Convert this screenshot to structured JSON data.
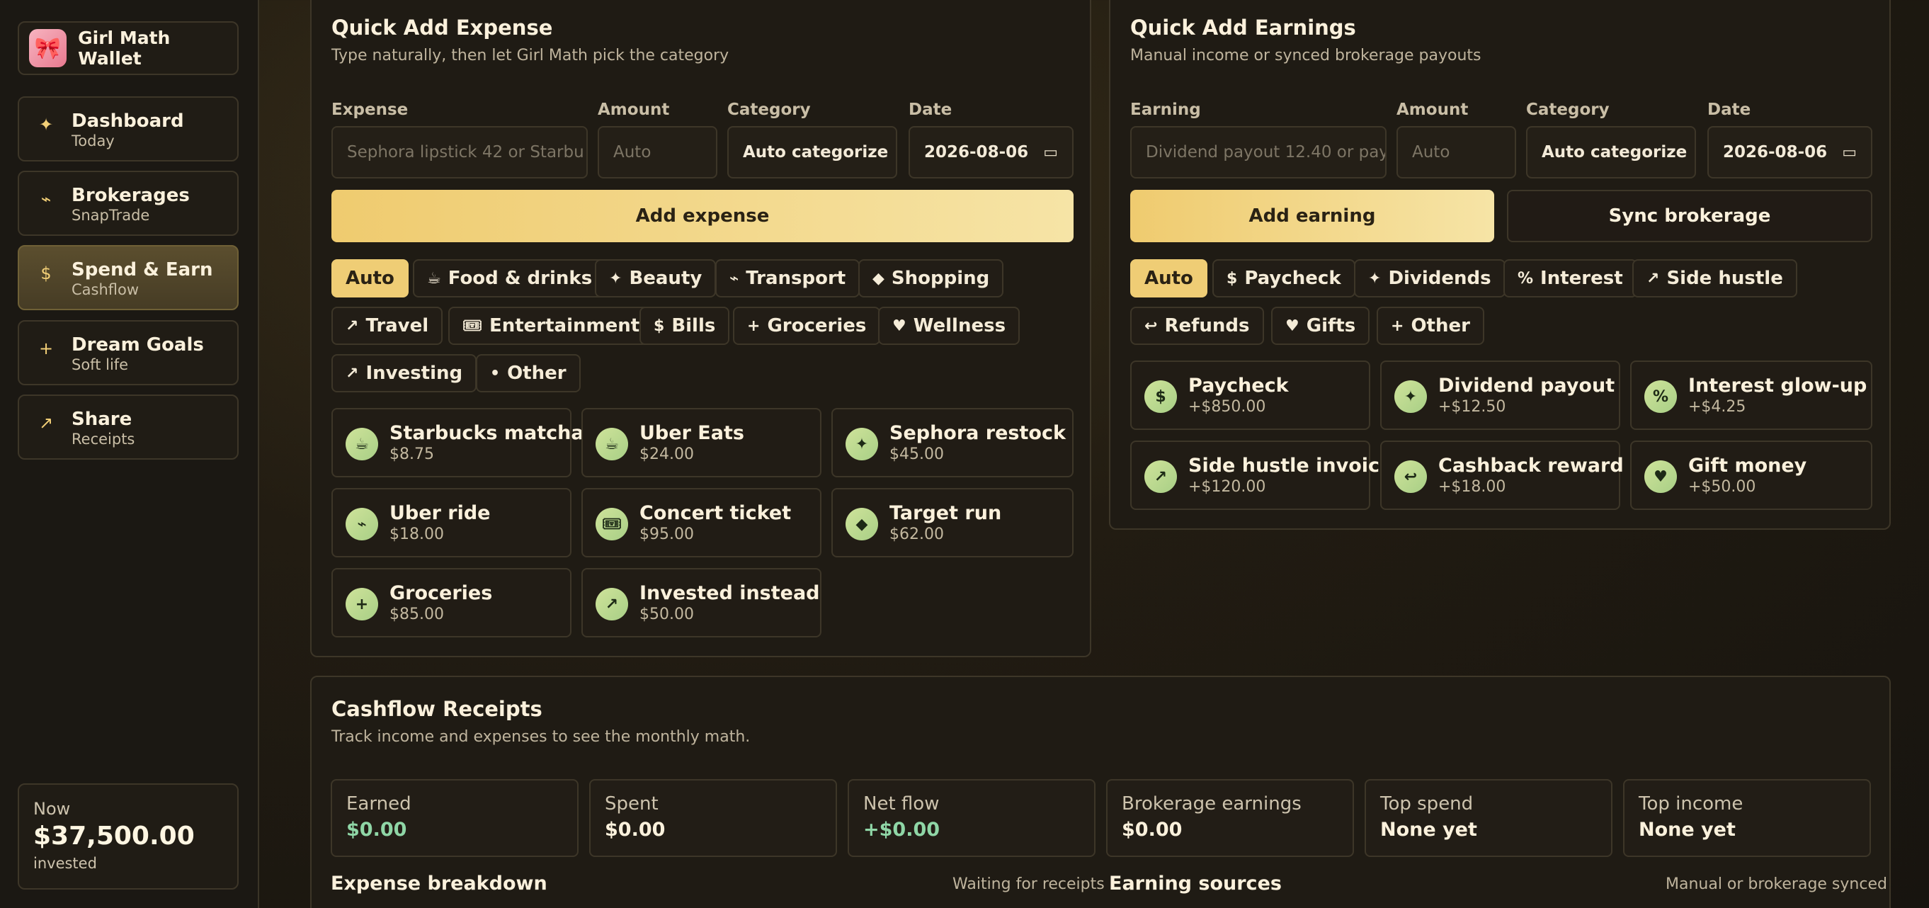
{
  "app": {
    "name": "Girl Math Wallet",
    "logo_icon": "🎀"
  },
  "sidebar": {
    "items": [
      {
        "icon": "✦",
        "title": "Dashboard",
        "sub": "Today"
      },
      {
        "icon": "⌁",
        "title": "Brokerages",
        "sub": "SnapTrade"
      },
      {
        "icon": "$",
        "title": "Spend & Earn",
        "sub": "Cashflow"
      },
      {
        "icon": "+",
        "title": "Dream Goals",
        "sub": "Soft life"
      },
      {
        "icon": "↗",
        "title": "Share",
        "sub": "Receipts"
      }
    ],
    "now": {
      "label": "Now",
      "value": "$37,500.00",
      "sub": "invested"
    }
  },
  "expense": {
    "title": "Quick Add Expense",
    "subtitle": "Type naturally, then let Girl Math pick the category",
    "labels": {
      "item": "Expense",
      "amount": "Amount",
      "category": "Category",
      "date": "Date"
    },
    "placeholders": {
      "item": "Sephora lipstick 42 or Starbu",
      "amount": "Auto"
    },
    "category_value": "Auto categorize",
    "date_value": "2026-08-06",
    "add_label": "Add expense",
    "chips": [
      {
        "icon": "",
        "label": "Auto"
      },
      {
        "icon": "☕",
        "label": "Food & drinks"
      },
      {
        "icon": "✦",
        "label": "Beauty"
      },
      {
        "icon": "⌁",
        "label": "Transport"
      },
      {
        "icon": "◆",
        "label": "Shopping"
      },
      {
        "icon": "↗",
        "label": "Travel"
      },
      {
        "icon": "🎟",
        "label": "Entertainment"
      },
      {
        "icon": "$",
        "label": "Bills"
      },
      {
        "icon": "+",
        "label": "Groceries"
      },
      {
        "icon": "♥",
        "label": "Wellness"
      },
      {
        "icon": "↗",
        "label": "Investing"
      },
      {
        "icon": "•",
        "label": "Other"
      }
    ],
    "tiles": [
      {
        "icon": "☕",
        "title": "Starbucks matcha",
        "amount": "$8.75"
      },
      {
        "icon": "☕",
        "title": "Uber Eats",
        "amount": "$24.00"
      },
      {
        "icon": "✦",
        "title": "Sephora restock",
        "amount": "$45.00"
      },
      {
        "icon": "⌁",
        "title": "Uber ride",
        "amount": "$18.00"
      },
      {
        "icon": "🎟",
        "title": "Concert ticket",
        "amount": "$95.00"
      },
      {
        "icon": "◆",
        "title": "Target run",
        "amount": "$62.00"
      },
      {
        "icon": "+",
        "title": "Groceries",
        "amount": "$85.00"
      },
      {
        "icon": "↗",
        "title": "Invested instead",
        "amount": "$50.00"
      }
    ]
  },
  "earnings": {
    "title": "Quick Add Earnings",
    "subtitle": "Manual income or synced brokerage payouts",
    "labels": {
      "item": "Earning",
      "amount": "Amount",
      "category": "Category",
      "date": "Date"
    },
    "placeholders": {
      "item": "Dividend payout 12.40 or pay",
      "amount": "Auto"
    },
    "category_value": "Auto categorize",
    "date_value": "2026-08-06",
    "add_label": "Add earning",
    "sync_label": "Sync brokerage",
    "chips": [
      {
        "icon": "",
        "label": "Auto"
      },
      {
        "icon": "$",
        "label": "Paycheck"
      },
      {
        "icon": "✦",
        "label": "Dividends"
      },
      {
        "icon": "%",
        "label": "Interest"
      },
      {
        "icon": "↗",
        "label": "Side hustle"
      },
      {
        "icon": "↩",
        "label": "Refunds"
      },
      {
        "icon": "♥",
        "label": "Gifts"
      },
      {
        "icon": "+",
        "label": "Other"
      }
    ],
    "tiles": [
      {
        "icon": "$",
        "title": "Paycheck",
        "amount": "+$850.00"
      },
      {
        "icon": "✦",
        "title": "Dividend payout",
        "amount": "+$12.50"
      },
      {
        "icon": "%",
        "title": "Interest glow-up",
        "amount": "+$4.25"
      },
      {
        "icon": "↗",
        "title": "Side hustle invoice",
        "amount": "+$120.00"
      },
      {
        "icon": "↩",
        "title": "Cashback reward",
        "amount": "+$18.00"
      },
      {
        "icon": "♥",
        "title": "Gift money",
        "amount": "+$50.00"
      }
    ]
  },
  "receipts": {
    "title": "Cashflow Receipts",
    "subtitle": "Track income and expenses to see the monthly math.",
    "stats": [
      {
        "label": "Earned",
        "value": "$0.00"
      },
      {
        "label": "Spent",
        "value": "$0.00"
      },
      {
        "label": "Net flow",
        "value": "+$0.00"
      },
      {
        "label": "Brokerage earnings",
        "value": "$0.00"
      },
      {
        "label": "Top spend",
        "value": "None yet"
      },
      {
        "label": "Top income",
        "value": "None yet"
      }
    ],
    "expense_breakdown": {
      "title": "Expense breakdown",
      "note": "Waiting for receipts"
    },
    "earning_sources": {
      "title": "Earning sources",
      "note": "Manual or brokerage synced"
    }
  },
  "colors": {
    "accent": "#efcd75",
    "positive": "#8fd6a6",
    "background": "#1b1813"
  }
}
